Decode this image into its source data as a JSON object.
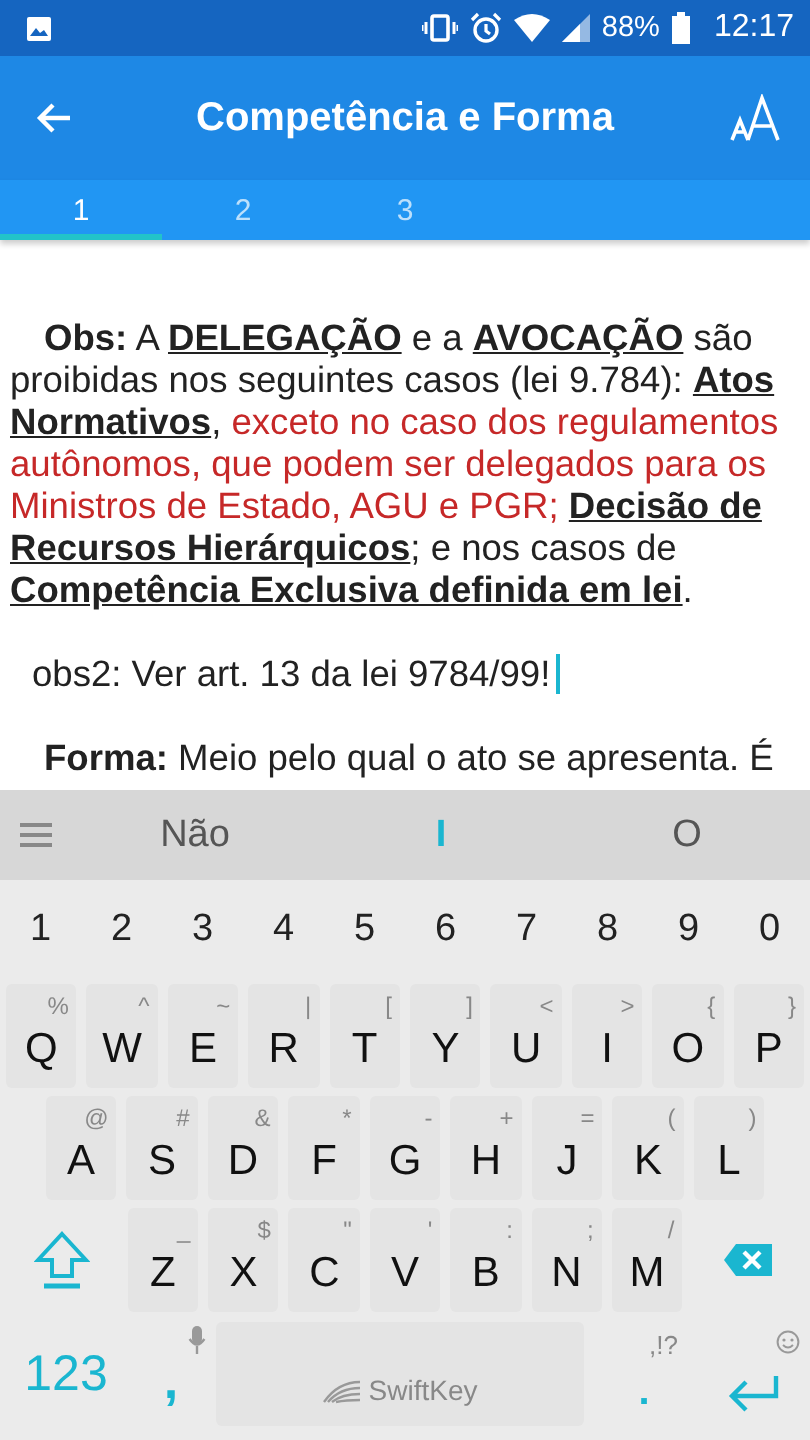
{
  "status_bar": {
    "battery": "88%",
    "time": "12:17"
  },
  "app_bar": {
    "title": "Competência e Forma"
  },
  "tabs": [
    {
      "label": "1",
      "selected": true
    },
    {
      "label": "2",
      "selected": false
    },
    {
      "label": "3",
      "selected": false
    }
  ],
  "content": {
    "paragraph": [
      {
        "kind": "bold",
        "text": "Obs:"
      },
      {
        "kind": "plain",
        "text": " A "
      },
      {
        "kind": "term",
        "text": "DELEGAÇÃO"
      },
      {
        "kind": "plain",
        "text": " e a "
      },
      {
        "kind": "term",
        "text": "AVOCAÇÃO"
      },
      {
        "kind": "plain",
        "text": " são proibidas nos seguintes casos (lei 9.784): "
      },
      {
        "kind": "term",
        "text": "Atos Normativos"
      },
      {
        "kind": "plain",
        "text": ", "
      },
      {
        "kind": "exception",
        "text": "exceto no caso dos regulamentos autônomos, que podem ser delegados para os Ministros de Estado, AGU e PGR; "
      },
      {
        "kind": "term",
        "text": "Decisão de Recursos Hierárquicos"
      },
      {
        "kind": "plain",
        "text": "; e nos casos de "
      },
      {
        "kind": "term",
        "text": "Competência Exclusiva definida em lei"
      },
      {
        "kind": "plain",
        "text": "."
      }
    ],
    "note": "obs2: Ver art. 13 da lei 9784/99!",
    "cut_line": [
      {
        "kind": "bold",
        "text": "Forma:"
      },
      {
        "kind": "plain",
        "text": " Meio pelo qual o ato se apresenta. É"
      }
    ]
  },
  "keyboard": {
    "suggestions": [
      {
        "text": "Não",
        "selected": false
      },
      {
        "text": "I",
        "selected": true
      },
      {
        "text": "O",
        "selected": false
      }
    ],
    "number_row": [
      "1",
      "2",
      "3",
      "4",
      "5",
      "6",
      "7",
      "8",
      "9",
      "0"
    ],
    "letter_rows": [
      [
        {
          "label": "Q",
          "alt": "%"
        },
        {
          "label": "W",
          "alt": "^"
        },
        {
          "label": "E",
          "alt": "~"
        },
        {
          "label": "R",
          "alt": "|"
        },
        {
          "label": "T",
          "alt": "["
        },
        {
          "label": "Y",
          "alt": "]"
        },
        {
          "label": "U",
          "alt": "<"
        },
        {
          "label": "I",
          "alt": ">"
        },
        {
          "label": "O",
          "alt": "{"
        },
        {
          "label": "P",
          "alt": "}"
        }
      ],
      [
        {
          "label": "A",
          "alt": "@"
        },
        {
          "label": "S",
          "alt": "#"
        },
        {
          "label": "D",
          "alt": "&"
        },
        {
          "label": "F",
          "alt": "*"
        },
        {
          "label": "G",
          "alt": "-"
        },
        {
          "label": "H",
          "alt": "+"
        },
        {
          "label": "J",
          "alt": "="
        },
        {
          "label": "K",
          "alt": "("
        },
        {
          "label": "L",
          "alt": ")"
        }
      ],
      [
        {
          "label": "Z",
          "alt": "_"
        },
        {
          "label": "X",
          "alt": "$"
        },
        {
          "label": "C",
          "alt": "\""
        },
        {
          "label": "V",
          "alt": "'"
        },
        {
          "label": "B",
          "alt": ":"
        },
        {
          "label": "N",
          "alt": ";"
        },
        {
          "label": "M",
          "alt": "/"
        }
      ]
    ],
    "mode_key": "123",
    "comma_key": ",",
    "space_brand": "SwiftKey",
    "period_key": ".",
    "punctuation_hint": ",!?"
  }
}
